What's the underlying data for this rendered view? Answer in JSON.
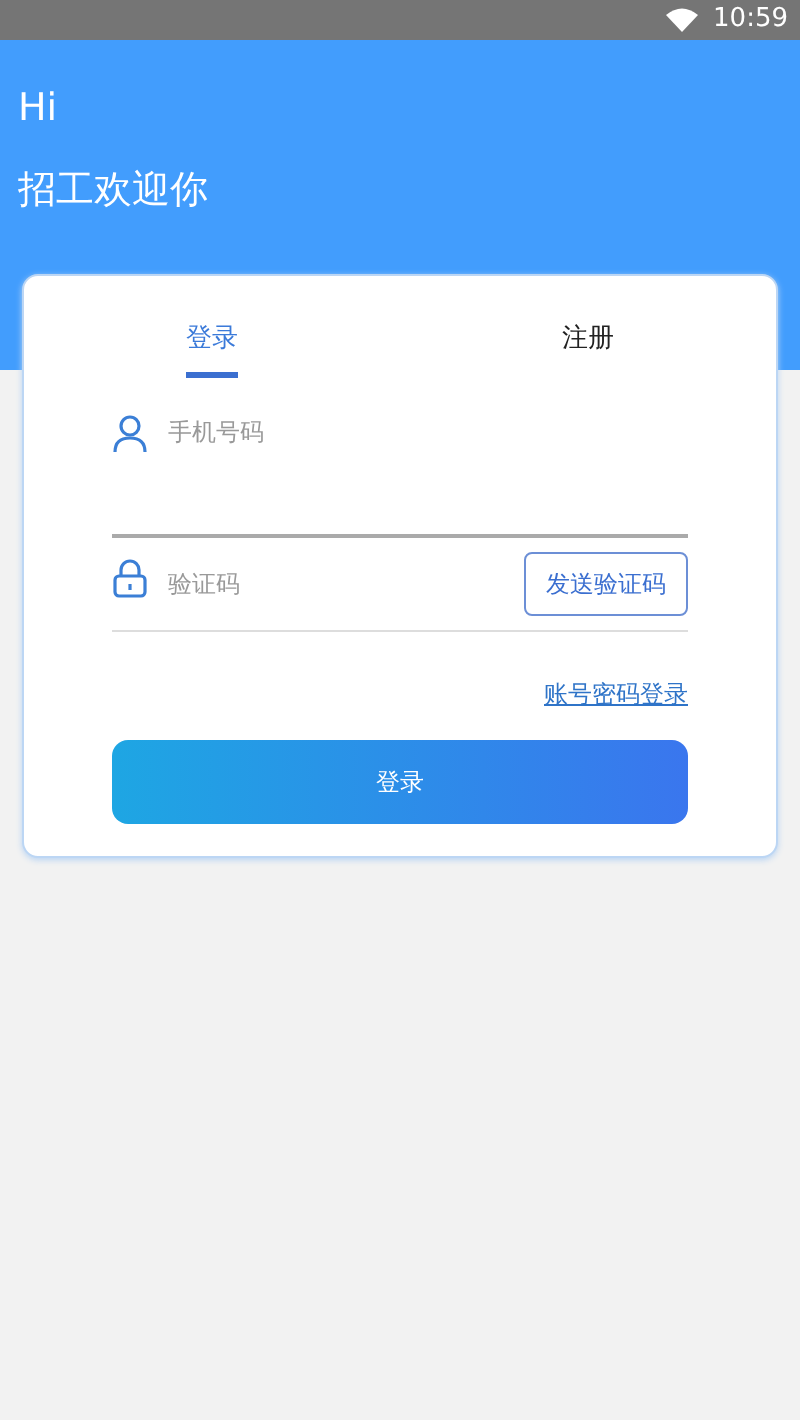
{
  "status_bar": {
    "time": "10:59"
  },
  "header": {
    "greeting": "Hi",
    "welcome": "招工欢迎你"
  },
  "tabs": [
    {
      "label": "登录",
      "selected": true
    },
    {
      "label": "注册",
      "selected": false
    }
  ],
  "fields": [
    {
      "kind": "phone",
      "placeholder": "手机号码",
      "focused": true
    },
    {
      "kind": "code",
      "placeholder": "验证码",
      "focused": false,
      "button": "发送验证码"
    }
  ],
  "alt_login_link": "账号密码登录",
  "submit_button": "登录"
}
